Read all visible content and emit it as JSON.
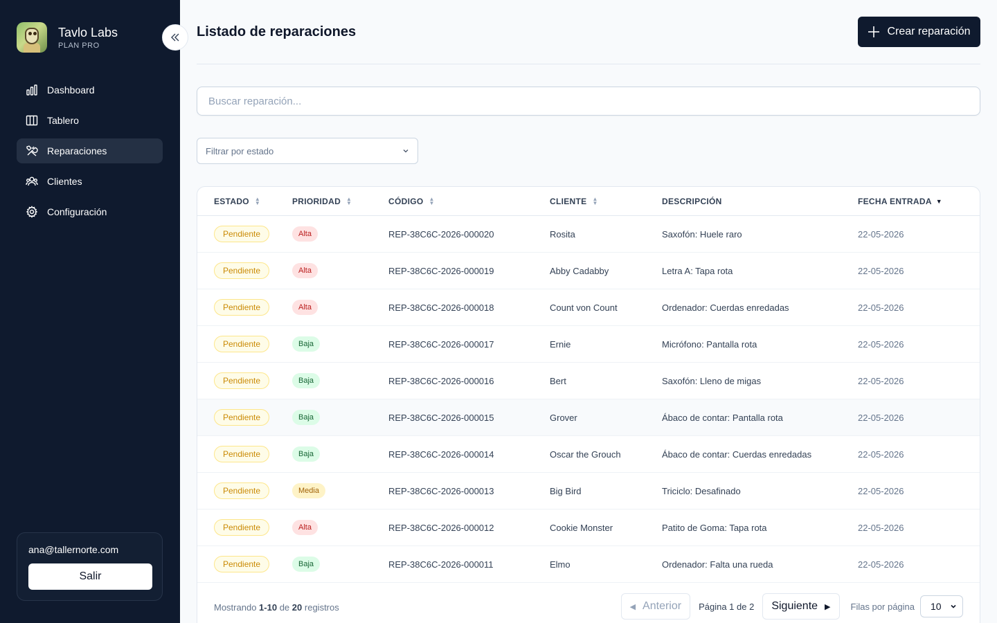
{
  "brand": {
    "name": "Tavlo Labs",
    "plan": "PLAN PRO"
  },
  "nav": [
    {
      "label": "Dashboard",
      "icon": "bar-chart-icon"
    },
    {
      "label": "Tablero",
      "icon": "columns-icon"
    },
    {
      "label": "Reparaciones",
      "icon": "tools-icon",
      "active": true
    },
    {
      "label": "Clientes",
      "icon": "users-icon"
    },
    {
      "label": "Configuración",
      "icon": "gear-icon"
    }
  ],
  "user": {
    "email": "ana@tallernorte.com",
    "logout_label": "Salir"
  },
  "header": {
    "title": "Listado de reparaciones",
    "create_label": "Crear reparación"
  },
  "search": {
    "placeholder": "Buscar reparación..."
  },
  "filter": {
    "placeholder": "Filtrar por estado"
  },
  "table": {
    "columns": [
      "ESTADO",
      "PRIORIDAD",
      "CÓDIGO",
      "CLIENTE",
      "DESCRIPCIÓN",
      "FECHA ENTRADA"
    ],
    "rows": [
      {
        "estado": "Pendiente",
        "prioridad": "Alta",
        "codigo": "REP-38C6C-2026-000020",
        "cliente": "Rosita",
        "descripcion": "Saxofón: Huele raro",
        "fecha": "22-05-2026"
      },
      {
        "estado": "Pendiente",
        "prioridad": "Alta",
        "codigo": "REP-38C6C-2026-000019",
        "cliente": "Abby Cadabby",
        "descripcion": "Letra A: Tapa rota",
        "fecha": "22-05-2026"
      },
      {
        "estado": "Pendiente",
        "prioridad": "Alta",
        "codigo": "REP-38C6C-2026-000018",
        "cliente": "Count von Count",
        "descripcion": "Ordenador: Cuerdas enredadas",
        "fecha": "22-05-2026"
      },
      {
        "estado": "Pendiente",
        "prioridad": "Baja",
        "codigo": "REP-38C6C-2026-000017",
        "cliente": "Ernie",
        "descripcion": "Micrófono: Pantalla rota",
        "fecha": "22-05-2026"
      },
      {
        "estado": "Pendiente",
        "prioridad": "Baja",
        "codigo": "REP-38C6C-2026-000016",
        "cliente": "Bert",
        "descripcion": "Saxofón: Lleno de migas",
        "fecha": "22-05-2026"
      },
      {
        "estado": "Pendiente",
        "prioridad": "Baja",
        "codigo": "REP-38C6C-2026-000015",
        "cliente": "Grover",
        "descripcion": "Ábaco de contar: Pantalla rota",
        "fecha": "22-05-2026"
      },
      {
        "estado": "Pendiente",
        "prioridad": "Baja",
        "codigo": "REP-38C6C-2026-000014",
        "cliente": "Oscar the Grouch",
        "descripcion": "Ábaco de contar: Cuerdas enredadas",
        "fecha": "22-05-2026"
      },
      {
        "estado": "Pendiente",
        "prioridad": "Media",
        "codigo": "REP-38C6C-2026-000013",
        "cliente": "Big Bird",
        "descripcion": "Triciclo: Desafinado",
        "fecha": "22-05-2026"
      },
      {
        "estado": "Pendiente",
        "prioridad": "Alta",
        "codigo": "REP-38C6C-2026-000012",
        "cliente": "Cookie Monster",
        "descripcion": "Patito de Goma: Tapa rota",
        "fecha": "22-05-2026"
      },
      {
        "estado": "Pendiente",
        "prioridad": "Baja",
        "codigo": "REP-38C6C-2026-000011",
        "cliente": "Elmo",
        "descripcion": "Ordenador: Falta una rueda",
        "fecha": "22-05-2026"
      }
    ]
  },
  "footer": {
    "showing_prefix": "Mostrando",
    "range": "1-10",
    "of": "de",
    "total": "20",
    "suffix": "registros",
    "prev_label": "Anterior",
    "page_info": "Página 1 de 2",
    "next_label": "Siguiente",
    "rows_per_page_label": "Filas por página",
    "rows_per_page": "10"
  },
  "colors": {
    "sidebar_bg": "#0f1a2e",
    "accent": "#0f1a2e",
    "status_pending": "#ca8a04",
    "priority_high": "#b91c1c",
    "priority_low": "#166534",
    "priority_medium": "#a16207"
  }
}
